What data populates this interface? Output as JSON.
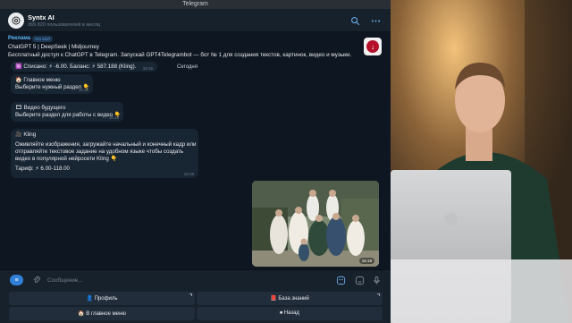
{
  "window": {
    "title": "Telegram"
  },
  "chat": {
    "name": "Syntx AI",
    "subtitle": "369 820 пользователей в месяц"
  },
  "ad": {
    "tag": "Реклама",
    "why": "что это?",
    "title": "ChatGPT 5 | DeepSeek | Midjourney",
    "text": "Бесплатный доступ к ChatGPT в Telegram. Запускай GPT4Telegrambot — бот № 1 для создания текстов, картинок, видео и музыки."
  },
  "messages": {
    "balance": {
      "text": "🆔 Списано: ⚡ -6.00. Баланс: ⚡ 587.188 (Kling).",
      "time": "16:16"
    },
    "date": "Сегодня",
    "main_menu": {
      "line1": "🏠 Главное меню",
      "line2": "Выберите нужный раздел 👇",
      "time": "16:18"
    },
    "video_future": {
      "line1": "🎞 Видео будущего",
      "line2": "Выберите раздел для работы с видео 👇",
      "time": "16:18"
    },
    "kling": {
      "title": "🎥 Kling",
      "body1": "Оживляйте изображения, загружайте начальный и конечный кадр или",
      "body2": "отправляйте текстовое задание на удобном языке чтобы создать",
      "body3": "видео в популярной нейросети Kling 👇",
      "tariff": "Тариф: ⚡ 6.00-118.00",
      "time": "16:18"
    },
    "photo": {
      "time": "16:19"
    }
  },
  "composer": {
    "placeholder": "Сообщение..."
  },
  "keyboard": {
    "buttons": [
      {
        "label": "👤 Профиль"
      },
      {
        "label": "📕 База знаний"
      },
      {
        "label": "🏠 В главное меню"
      },
      {
        "label": "⏹ Назад"
      }
    ]
  },
  "colors": {
    "accent": "#2f80d6",
    "bubble": "#182533",
    "background": "#0e1621",
    "link": "#5eb5f7"
  },
  "icons": [
    "search-icon",
    "more-vertical-icon",
    "menu-icon",
    "paperclip-icon",
    "sticker-icon",
    "emoji-icon",
    "microphone-icon"
  ]
}
